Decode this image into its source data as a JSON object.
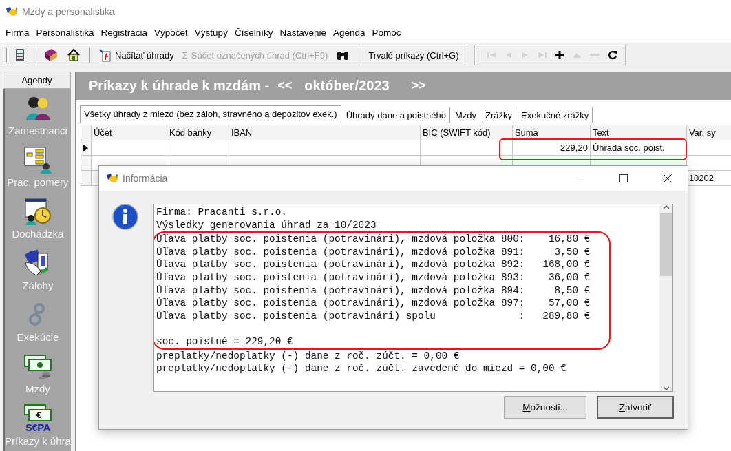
{
  "window": {
    "title": "Mzdy a personalistika"
  },
  "menu": [
    "Firma",
    "Personalistika",
    "Registrácia",
    "Výpočet",
    "Výstupy",
    "Číselníky",
    "Nastavenie",
    "Agenda",
    "Pomoc"
  ],
  "toolbar": {
    "bands": [
      {
        "items": [
          {
            "kind": "icon",
            "disabled": false
          },
          {
            "kind": "separator"
          },
          {
            "kind": "icon",
            "disabled": false
          },
          {
            "kind": "icon",
            "disabled": false
          },
          {
            "kind": "separator"
          },
          {
            "kind": "button",
            "label": "Načítať úhrady",
            "disabled": false
          },
          {
            "kind": "button",
            "glyph": "Σ",
            "label": "Súčet označených úhrad (Ctrl+F9)",
            "disabled": true
          },
          {
            "kind": "icon",
            "disabled": false
          },
          {
            "kind": "separator"
          },
          {
            "kind": "button",
            "label": "Trvalé príkazy (Ctrl+G)",
            "disabled": false
          }
        ]
      },
      {
        "items": [
          {
            "kind": "icon",
            "disabled": true
          },
          {
            "kind": "icon",
            "disabled": true
          },
          {
            "kind": "icon",
            "disabled": true
          },
          {
            "kind": "icon",
            "disabled": true
          },
          {
            "kind": "icon",
            "disabled": false
          },
          {
            "kind": "icon",
            "disabled": true
          },
          {
            "kind": "icon",
            "disabled": true
          },
          {
            "kind": "icon",
            "disabled": false
          }
        ]
      }
    ]
  },
  "sidebar": {
    "title": "Agendy",
    "items": [
      {
        "label": "Zamestnanci"
      },
      {
        "label": "Prac. pomery"
      },
      {
        "label": "Dochádzka"
      },
      {
        "label": "Zálohy"
      },
      {
        "label": "Exekúcie"
      },
      {
        "label": "Mzdy"
      },
      {
        "label": "Príkazy k úhra",
        "icon_text": "€",
        "logo_text": "S€PA"
      }
    ]
  },
  "header": {
    "title": "Príkazy k úhrade k mzdám -",
    "prev": "<<",
    "period": "október/2023",
    "next": ">>"
  },
  "tabs": [
    {
      "label": "Všetky úhrady z miezd (bez záloh, stravného a depozitov exek.)",
      "selected": true
    },
    {
      "label": "Úhrady dane a poistného",
      "selected": false
    },
    {
      "label": "Mzdy",
      "selected": false
    },
    {
      "label": "Zrážky",
      "selected": false
    },
    {
      "label": "Exekučné zrážky",
      "selected": false
    }
  ],
  "table": {
    "columns": [
      "Účet",
      "Kód banky",
      "IBAN",
      "BIC (SWIFT kód)",
      "Suma",
      "Text",
      "Var. sy"
    ],
    "rows": [
      {
        "selected": true,
        "highlighted": true,
        "cells": [
          null,
          null,
          null,
          null,
          "229,20",
          "Úhrada soc. poist.",
          null
        ]
      },
      {
        "selected": false,
        "highlighted": false,
        "cells": [
          null,
          null,
          null,
          null,
          null,
          null,
          null
        ]
      },
      {
        "selected": false,
        "highlighted": false,
        "cells": [
          null,
          null,
          null,
          null,
          null,
          null,
          "10202"
        ]
      }
    ]
  },
  "dialog": {
    "title": "Informácia",
    "blocks": [
      {
        "highlighted": false,
        "lines": [
          {
            "kind": "text",
            "text": "Firma: Pracanti s.r.o."
          },
          {
            "kind": "text",
            "text": "Výsledky generovania úhrad za 10/2023"
          }
        ]
      },
      {
        "highlighted": true,
        "lines": [
          {
            "kind": "text",
            "text": "Úľava platby soc. poistenia (potravinári), mzdová položka 800:    16,80 €"
          },
          {
            "kind": "text",
            "text": "Úľava platby soc. poistenia (potravinári), mzdová položka 891:     3,50 €"
          },
          {
            "kind": "text",
            "text": "Úľava platby soc. poistenia (potravinári), mzdová položka 892:   168,00 €"
          },
          {
            "kind": "text",
            "text": "Úľava platby soc. poistenia (potravinári), mzdová položka 893:    36,00 €"
          },
          {
            "kind": "text",
            "text": "Úľava platby soc. poistenia (potravinári), mzdová položka 894:     8,50 €"
          },
          {
            "kind": "text",
            "text": "Úľava platby soc. poistenia (potravinári), mzdová položka 897:    57,00 €"
          },
          {
            "kind": "text",
            "text": "Úľava platby soc. poistenia (potravinári) spolu              :   289,80 €"
          },
          {
            "kind": "blank"
          },
          {
            "kind": "text",
            "text": "soc. poistné = 229,20 €"
          }
        ]
      },
      {
        "highlighted": false,
        "lines": [
          {
            "kind": "text",
            "text": "preplatky/nedoplatky (-) dane z roč. zúčt. = 0,00 €"
          },
          {
            "kind": "text",
            "text": "preplatky/nedoplatky (-) dane z roč. zúčt. zavedené do miezd = 0,00 €"
          }
        ]
      }
    ],
    "buttons": [
      "Možnosti...",
      "Zatvoriť"
    ]
  }
}
